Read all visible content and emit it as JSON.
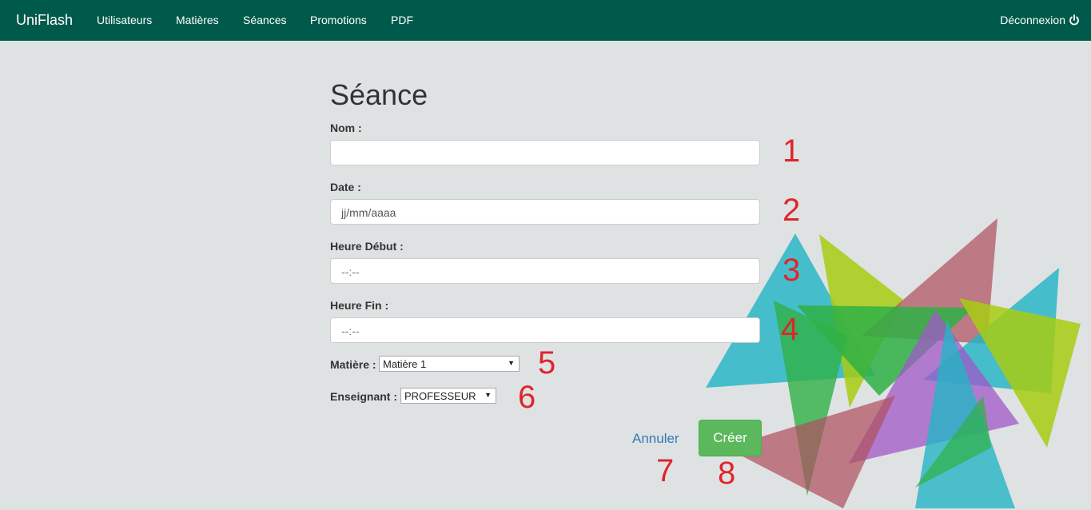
{
  "nav": {
    "brand": "UniFlash",
    "links": [
      "Utilisateurs",
      "Matières",
      "Séances",
      "Promotions",
      "PDF"
    ],
    "logout": "Déconnexion",
    "logout_icon": "power-icon"
  },
  "form": {
    "title": "Séance",
    "nom_label": "Nom :",
    "nom_value": "",
    "date_label": "Date :",
    "date_placeholder": "jj/mm/aaaa",
    "heure_debut_label": "Heure Début :",
    "heure_debut_placeholder": "--:--",
    "heure_fin_label": "Heure Fin :",
    "heure_fin_placeholder": "--:--",
    "matiere_label": "Matière :",
    "matiere_selected": "Matière 1",
    "enseignant_label": "Enseignant :",
    "enseignant_selected": "PROFESSEUR",
    "cancel_label": "Annuler",
    "submit_label": "Créer"
  },
  "annotations": [
    "1",
    "2",
    "3",
    "4",
    "5",
    "6",
    "7",
    "8"
  ],
  "colors": {
    "navbar": "#005a4b",
    "background": "#dfe2e3",
    "submit": "#5cb85c",
    "link": "#337ab7",
    "annotation": "#e0252b"
  }
}
